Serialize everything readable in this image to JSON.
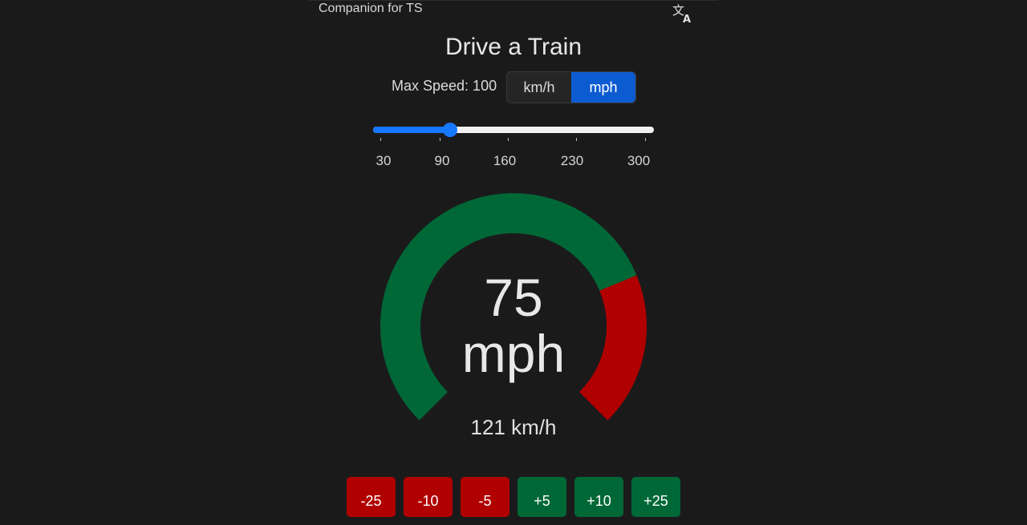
{
  "app": {
    "title": "Companion for TS",
    "icon": "translate-icon"
  },
  "page": {
    "title": "Drive a Train"
  },
  "max_speed": {
    "label": "Max Speed: 100",
    "value": 100
  },
  "units": {
    "options": [
      "km/h",
      "mph"
    ],
    "selected": "mph"
  },
  "slider": {
    "ticks": [
      "30",
      "90",
      "160",
      "230",
      "300"
    ],
    "min": 30,
    "max": 300,
    "value": 100
  },
  "speedometer": {
    "speed": "75",
    "unit": "mph",
    "alt_speed": "121 km/h",
    "speed_fraction_of_max": 0.75,
    "colors": {
      "under": "#006837",
      "over": "#b00000",
      "accent": "#0d5bd1"
    }
  },
  "adjust_buttons": [
    {
      "label": "-25",
      "kind": "minus"
    },
    {
      "label": "-10",
      "kind": "minus"
    },
    {
      "label": "-5",
      "kind": "minus"
    },
    {
      "label": "+5",
      "kind": "plus"
    },
    {
      "label": "+10",
      "kind": "plus"
    },
    {
      "label": "+25",
      "kind": "plus"
    }
  ]
}
